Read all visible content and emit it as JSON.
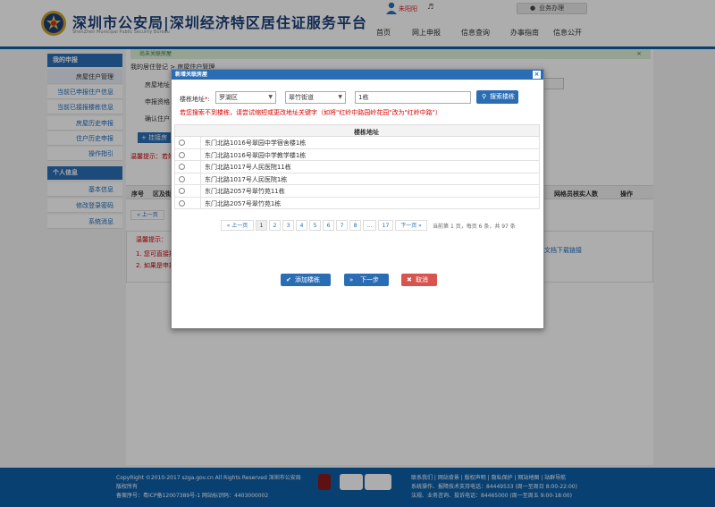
{
  "header": {
    "brand": "深圳市公安局|深圳经济特区居住证服务平台",
    "brand_sub": "ShenZhen Municipal Public Security Bureau",
    "user_name": "朱阳阳",
    "business_menu": "业务办理",
    "nav": [
      "首页",
      "网上申报",
      "信息查询",
      "办事指南",
      "信息公开"
    ]
  },
  "sidebar": {
    "section1_title": "我的申报",
    "section1_items": [
      "房屋住户管理",
      "当前已申报住户信息",
      "当前已接报楼栋信息",
      "房屋历史申报",
      "住户历史申报",
      "操作指引"
    ],
    "section2_title": "个人信息",
    "section2_items": [
      "基本信息",
      "修改登录密码",
      "系统消息"
    ]
  },
  "background": {
    "notice": "尚未关联房屋",
    "breadcrumb": "我的居住登记 > 房屋住户管理",
    "labels": [
      "房屋地址",
      "申报资格",
      "确认住户"
    ],
    "add_button": "挂接房",
    "warning": "温馨提示：若姓名",
    "table_headers": [
      "序号",
      "区及街",
      "网格员核实人数",
      "操作"
    ],
    "prev_page": "« 上一页",
    "tips_title": "温馨提示：",
    "tips": [
      "1. 您可直接挂",
      "2. 如果是申报"
    ],
    "download_link": "文档下载链接"
  },
  "modal": {
    "title": "新增关联房屋",
    "close_label": "×",
    "form_label": "楼栋地址",
    "required_mark": "*",
    "district": "罗湖区",
    "street": "翠竹街道",
    "keyword": "1栋",
    "search_button": "搜索楼栋",
    "hint": "若您搜索不到楼栋，请尝试缩短或更改地址关键字（如将\"红岭中路园岭花园\"改为\"红岭中路\"）",
    "column_header": "楼栋地址",
    "rows": [
      "东门北路1016号翠园中学宿舍楼1栋",
      "东门北路1016号翠园中学教学楼1栋",
      "东门北路1017号人民医院11栋",
      "东门北路1017号人民医院1栋",
      "东门北路2057号翠竹苑11栋",
      "东门北路2057号翠竹苑1栋"
    ],
    "pager": {
      "prev": "« 上一页",
      "pages": [
        "1",
        "2",
        "3",
        "4",
        "5",
        "6",
        "7",
        "8",
        "...",
        "17"
      ],
      "next": "下一页 »",
      "current_label": "当前第",
      "current_page": "1",
      "info": "页，每页 6 条，共 97 条"
    },
    "buttons": {
      "add": "添加楼栋",
      "next": "下一步",
      "cancel": "取消"
    }
  },
  "footer": {
    "copyright": "CopyRight ©2010-2017 szga.gov.cn All Rights Reserved 深圳市公安局",
    "rights": "版权所有",
    "icp": "备案序号：粤ICP备12007389号-1 网站标识码：4403000002",
    "links": "联系我们 | 网站背景 | 版权声明 | 隐私保护 | 网站地图 | 站群导航",
    "support1": "系统操作、报障技术支持电话：84449533 (周一至周日 8:00-22:00)",
    "support2": "法规、业务咨询、投诉电话：84465000 (周一至周五 9:00-18:00)"
  },
  "colors": {
    "primary_blue": "#2a6db5",
    "footer_blue": "#0d5fa8",
    "danger_red": "#d9534f",
    "notice_green": "#dff0d8"
  }
}
